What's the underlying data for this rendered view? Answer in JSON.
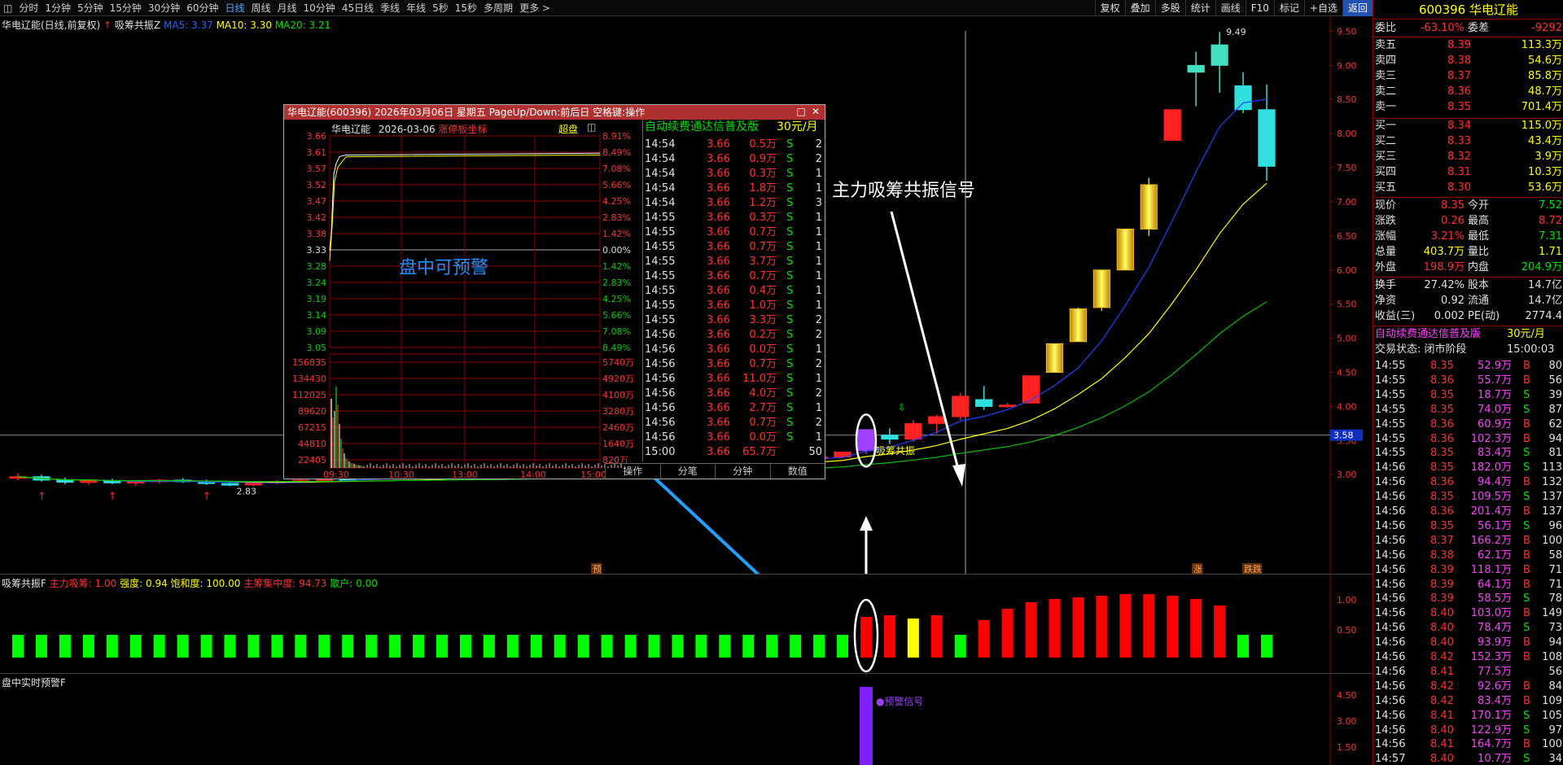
{
  "topbar": {
    "tabs": [
      "分时",
      "1分钟",
      "5分钟",
      "15分钟",
      "30分钟",
      "60分钟",
      "日线",
      "周线",
      "月线",
      "10分钟",
      "45日线",
      "季线",
      "年线",
      "5秒",
      "15秒",
      "多周期",
      "更多 >"
    ],
    "active": "日线",
    "tools": [
      "复权",
      "叠加",
      "多股",
      "统计",
      "画线",
      "F10",
      "标记",
      "+自选",
      "返回"
    ]
  },
  "main": {
    "title": "华电辽能(日线,前复权)",
    "indicator": "吸筹共振Z",
    "ma5": "MA5: 3.37",
    "ma10": "MA10: 3.30",
    "ma20": "MA20: 3.21",
    "yaxis": [
      "9.50",
      "9.00",
      "8.50",
      "8.00",
      "7.50",
      "7.00",
      "6.50",
      "6.00",
      "5.50",
      "5.00",
      "4.50",
      "4.00",
      "3.50",
      "3.00"
    ],
    "price_tag": "3.58",
    "max_label": "9.49",
    "min_label": "2.83",
    "signal_text": "吸筹共振",
    "bottom_tags": [
      "预",
      "涨",
      "跌跌"
    ]
  },
  "sub1": {
    "title": "吸筹共振F",
    "main_label": "主力吸筹: 1.00",
    "strength": "强度: 0.94",
    "sat": "饱和度: 100.00",
    "conc": "主筹集中度: 94.73",
    "retail": "散户: 0.00",
    "yaxis": [
      "1.00",
      "0.50"
    ]
  },
  "sub2": {
    "title": "盘中实时预警F",
    "signal": "●预警信号",
    "yaxis": [
      "4.50",
      "3.00",
      "1.50"
    ]
  },
  "annotations": {
    "main_signal": "主力吸筹共振信号",
    "intraday": "盘中可预警"
  },
  "popup": {
    "title": "华电辽能(600396) 2026年03月06日 星期五 PageUp/Down:前后日 空格键:操作",
    "mini_title": "华电辽能",
    "mini_date": "2026-03-06",
    "mini_limit": "涨停板坐标",
    "mini_btn": "超盘",
    "price_labels": [
      "3.66",
      "3.61",
      "3.57",
      "3.52",
      "3.47",
      "3.42",
      "3.38",
      "3.33",
      "3.28",
      "3.24",
      "3.19",
      "3.14",
      "3.09",
      "3.05"
    ],
    "pct_labels": [
      "8.91%",
      "8.49%",
      "7.08%",
      "5.66%",
      "4.25%",
      "2.83%",
      "1.42%",
      "0.00%",
      "1.42%",
      "2.83%",
      "4.25%",
      "5.66%",
      "7.08%",
      "8.49%"
    ],
    "vol_labels": [
      "156835",
      "134430",
      "112025",
      "89620",
      "67215",
      "44810",
      "22405"
    ],
    "vol_right": [
      "5740万",
      "4920万",
      "4100万",
      "3280万",
      "2460万",
      "1640万",
      "820万"
    ],
    "times": [
      "09:30",
      "10:30",
      "13:00",
      "14:00",
      "15:00"
    ],
    "tick_header": "自动续费通达信普及版",
    "tick_price": "30元/月",
    "ticks": [
      [
        "14:54",
        "3.66",
        "0.5万",
        "S",
        "2"
      ],
      [
        "14:54",
        "3.66",
        "0.9万",
        "S",
        "2"
      ],
      [
        "14:54",
        "3.66",
        "0.3万",
        "S",
        "1"
      ],
      [
        "14:54",
        "3.66",
        "1.8万",
        "S",
        "1"
      ],
      [
        "14:54",
        "3.66",
        "1.2万",
        "S",
        "3"
      ],
      [
        "14:55",
        "3.66",
        "0.3万",
        "S",
        "1"
      ],
      [
        "14:55",
        "3.66",
        "0.7万",
        "S",
        "1"
      ],
      [
        "14:55",
        "3.66",
        "0.7万",
        "S",
        "1"
      ],
      [
        "14:55",
        "3.66",
        "3.7万",
        "S",
        "1"
      ],
      [
        "14:55",
        "3.66",
        "0.7万",
        "S",
        "1"
      ],
      [
        "14:55",
        "3.66",
        "0.4万",
        "S",
        "1"
      ],
      [
        "14:55",
        "3.66",
        "1.0万",
        "S",
        "1"
      ],
      [
        "14:55",
        "3.66",
        "3.3万",
        "S",
        "2"
      ],
      [
        "14:56",
        "3.66",
        "0.2万",
        "S",
        "2"
      ],
      [
        "14:56",
        "3.66",
        "0.0万",
        "S",
        "1"
      ],
      [
        "14:56",
        "3.66",
        "0.7万",
        "S",
        "2"
      ],
      [
        "14:56",
        "3.66",
        "11.0万",
        "S",
        "1"
      ],
      [
        "14:56",
        "3.66",
        "4.0万",
        "S",
        "2"
      ],
      [
        "14:56",
        "3.66",
        "2.7万",
        "S",
        "1"
      ],
      [
        "14:56",
        "3.66",
        "0.7万",
        "S",
        "2"
      ],
      [
        "14:56",
        "3.66",
        "0.0万",
        "S",
        "1"
      ],
      [
        "15:00",
        "3.66",
        "65.7万",
        "",
        "50"
      ]
    ],
    "buttons": [
      "操作",
      "分笔",
      "分钟",
      "数值"
    ]
  },
  "right": {
    "code": "600396",
    "name": "华电辽能",
    "weibi_label": "委比",
    "weibi": "-63.10%",
    "weicha_label": "委差",
    "weicha": "-9292",
    "asks": [
      [
        "卖五",
        "8.39",
        "113.3万"
      ],
      [
        "卖四",
        "8.38",
        "54.6万"
      ],
      [
        "卖三",
        "8.37",
        "85.8万"
      ],
      [
        "卖二",
        "8.36",
        "48.7万"
      ],
      [
        "卖一",
        "8.35",
        "701.4万"
      ]
    ],
    "bids": [
      [
        "买一",
        "8.34",
        "115.0万"
      ],
      [
        "买二",
        "8.33",
        "43.4万"
      ],
      [
        "买三",
        "8.32",
        "3.9万"
      ],
      [
        "买四",
        "8.31",
        "10.3万"
      ],
      [
        "买五",
        "8.30",
        "53.6万"
      ]
    ],
    "stats": [
      [
        "现价",
        "8.35",
        "今开",
        "7.52"
      ],
      [
        "涨跌",
        "0.26",
        "最高",
        "8.72"
      ],
      [
        "涨幅",
        "3.21%",
        "最低",
        "7.31"
      ],
      [
        "总量",
        "403.7万",
        "量比",
        "1.71"
      ],
      [
        "外盘",
        "198.9万",
        "内盘",
        "204.9万"
      ]
    ],
    "stats2": [
      [
        "换手",
        "27.42%",
        "股本",
        "14.7亿"
      ],
      [
        "净资",
        "0.92",
        "流通",
        "14.7亿"
      ],
      [
        "收益(三)",
        "0.002",
        "PE(动)",
        "2774.4"
      ]
    ],
    "ad": "自动续费通达信普及版",
    "ad_price": "30元/月",
    "trade_state": "交易状态: 闭市阶段",
    "trade_time": "15:00:03",
    "trades": [
      [
        "14:55",
        "8.35",
        "52.9万",
        "B",
        "80"
      ],
      [
        "14:55",
        "8.36",
        "55.7万",
        "B",
        "56"
      ],
      [
        "14:55",
        "8.35",
        "18.7万",
        "S",
        "39"
      ],
      [
        "14:55",
        "8.35",
        "74.0万",
        "S",
        "87"
      ],
      [
        "14:55",
        "8.36",
        "60.9万",
        "B",
        "62"
      ],
      [
        "14:55",
        "8.36",
        "102.3万",
        "B",
        "94"
      ],
      [
        "14:55",
        "8.35",
        "83.4万",
        "S",
        "81"
      ],
      [
        "14:56",
        "8.35",
        "182.0万",
        "S",
        "113"
      ],
      [
        "14:56",
        "8.36",
        "94.4万",
        "B",
        "132"
      ],
      [
        "14:56",
        "8.35",
        "109.5万",
        "S",
        "137"
      ],
      [
        "14:56",
        "8.36",
        "201.4万",
        "B",
        "137"
      ],
      [
        "14:56",
        "8.35",
        "56.1万",
        "S",
        "96"
      ],
      [
        "14:56",
        "8.37",
        "166.2万",
        "B",
        "100"
      ],
      [
        "14:56",
        "8.38",
        "62.1万",
        "B",
        "58"
      ],
      [
        "14:56",
        "8.39",
        "118.1万",
        "B",
        "71"
      ],
      [
        "14:56",
        "8.39",
        "64.1万",
        "B",
        "71"
      ],
      [
        "14:56",
        "8.39",
        "58.5万",
        "S",
        "78"
      ],
      [
        "14:56",
        "8.40",
        "103.0万",
        "B",
        "149"
      ],
      [
        "14:56",
        "8.40",
        "78.4万",
        "S",
        "73"
      ],
      [
        "14:56",
        "8.40",
        "93.9万",
        "B",
        "94"
      ],
      [
        "14:56",
        "8.42",
        "152.3万",
        "B",
        "108"
      ],
      [
        "14:56",
        "8.41",
        "77.5万",
        "",
        "56"
      ],
      [
        "14:56",
        "8.42",
        "92.6万",
        "B",
        "84"
      ],
      [
        "14:56",
        "8.42",
        "83.4万",
        "B",
        "109"
      ],
      [
        "14:56",
        "8.41",
        "170.1万",
        "S",
        "105"
      ],
      [
        "14:56",
        "8.40",
        "122.9万",
        "S",
        "97"
      ],
      [
        "14:56",
        "8.41",
        "164.7万",
        "B",
        "100"
      ],
      [
        "14:57",
        "8.40",
        "10.7万",
        "S",
        "34"
      ]
    ]
  },
  "chart_data": {
    "type": "candlestick",
    "title": "华电辽能(日线,前复权)",
    "ylim": [
      2.8,
      9.6
    ],
    "candles": [
      [
        2.95,
        3.02,
        2.92,
        2.97
      ],
      [
        2.97,
        3.0,
        2.9,
        2.92
      ],
      [
        2.92,
        2.96,
        2.86,
        2.89
      ],
      [
        2.89,
        2.93,
        2.85,
        2.91
      ],
      [
        2.91,
        2.94,
        2.86,
        2.88
      ],
      [
        2.88,
        2.92,
        2.84,
        2.9
      ],
      [
        2.9,
        2.94,
        2.87,
        2.92
      ],
      [
        2.92,
        2.95,
        2.88,
        2.9
      ],
      [
        2.9,
        2.93,
        2.85,
        2.87
      ],
      [
        2.87,
        2.9,
        2.83,
        2.85
      ],
      [
        2.85,
        2.89,
        2.83,
        2.88
      ],
      [
        2.88,
        2.92,
        2.86,
        2.9
      ],
      [
        2.9,
        2.94,
        2.88,
        2.92
      ],
      [
        2.92,
        2.96,
        2.9,
        2.94
      ],
      [
        2.94,
        2.97,
        2.91,
        2.93
      ],
      [
        2.93,
        2.98,
        2.91,
        2.96
      ],
      [
        2.96,
        3.0,
        2.94,
        2.98
      ],
      [
        2.98,
        3.02,
        2.95,
        2.97
      ],
      [
        2.97,
        3.0,
        2.94,
        2.99
      ],
      [
        2.99,
        3.04,
        2.97,
        3.02
      ],
      [
        3.02,
        3.05,
        2.98,
        3.0
      ],
      [
        3.0,
        3.03,
        2.97,
        3.01
      ],
      [
        3.01,
        3.05,
        2.99,
        3.04
      ],
      [
        3.04,
        3.08,
        3.02,
        3.06
      ],
      [
        3.06,
        3.09,
        3.03,
        3.05
      ],
      [
        3.05,
        3.08,
        3.02,
        3.07
      ],
      [
        3.07,
        3.11,
        3.05,
        3.1
      ],
      [
        3.1,
        3.14,
        3.08,
        3.12
      ],
      [
        3.12,
        3.16,
        3.1,
        3.18
      ],
      [
        3.18,
        3.22,
        3.14,
        3.2
      ],
      [
        3.2,
        3.25,
        3.17,
        3.23
      ],
      [
        3.23,
        3.26,
        3.19,
        3.21
      ],
      [
        3.21,
        3.24,
        3.18,
        3.22
      ],
      [
        3.22,
        3.25,
        3.19,
        3.24
      ],
      [
        3.24,
        3.27,
        3.2,
        3.26
      ],
      [
        3.26,
        3.3,
        3.24,
        3.33
      ],
      [
        3.35,
        3.66,
        3.3,
        3.66
      ],
      [
        3.58,
        3.68,
        3.45,
        3.52
      ],
      [
        3.52,
        3.8,
        3.48,
        3.75
      ],
      [
        3.75,
        3.88,
        3.6,
        3.85
      ],
      [
        3.85,
        4.2,
        3.8,
        4.15
      ],
      [
        4.1,
        4.3,
        3.95,
        4.0
      ],
      [
        4.0,
        4.05,
        3.98,
        4.02
      ],
      [
        4.05,
        4.45,
        4.04,
        4.45
      ],
      [
        4.5,
        4.92,
        4.5,
        4.92
      ],
      [
        4.95,
        5.45,
        4.95,
        5.43
      ],
      [
        5.45,
        6.0,
        5.4,
        6.0
      ],
      [
        6.0,
        6.6,
        6.0,
        6.6
      ],
      [
        6.6,
        7.35,
        6.5,
        7.25
      ],
      [
        7.9,
        8.35,
        7.9,
        8.35
      ],
      [
        8.9,
        9.2,
        8.4,
        9.0
      ],
      [
        9.0,
        9.49,
        8.6,
        9.3
      ],
      [
        8.7,
        8.9,
        8.3,
        8.35
      ],
      [
        8.35,
        8.72,
        7.31,
        7.52
      ]
    ]
  }
}
